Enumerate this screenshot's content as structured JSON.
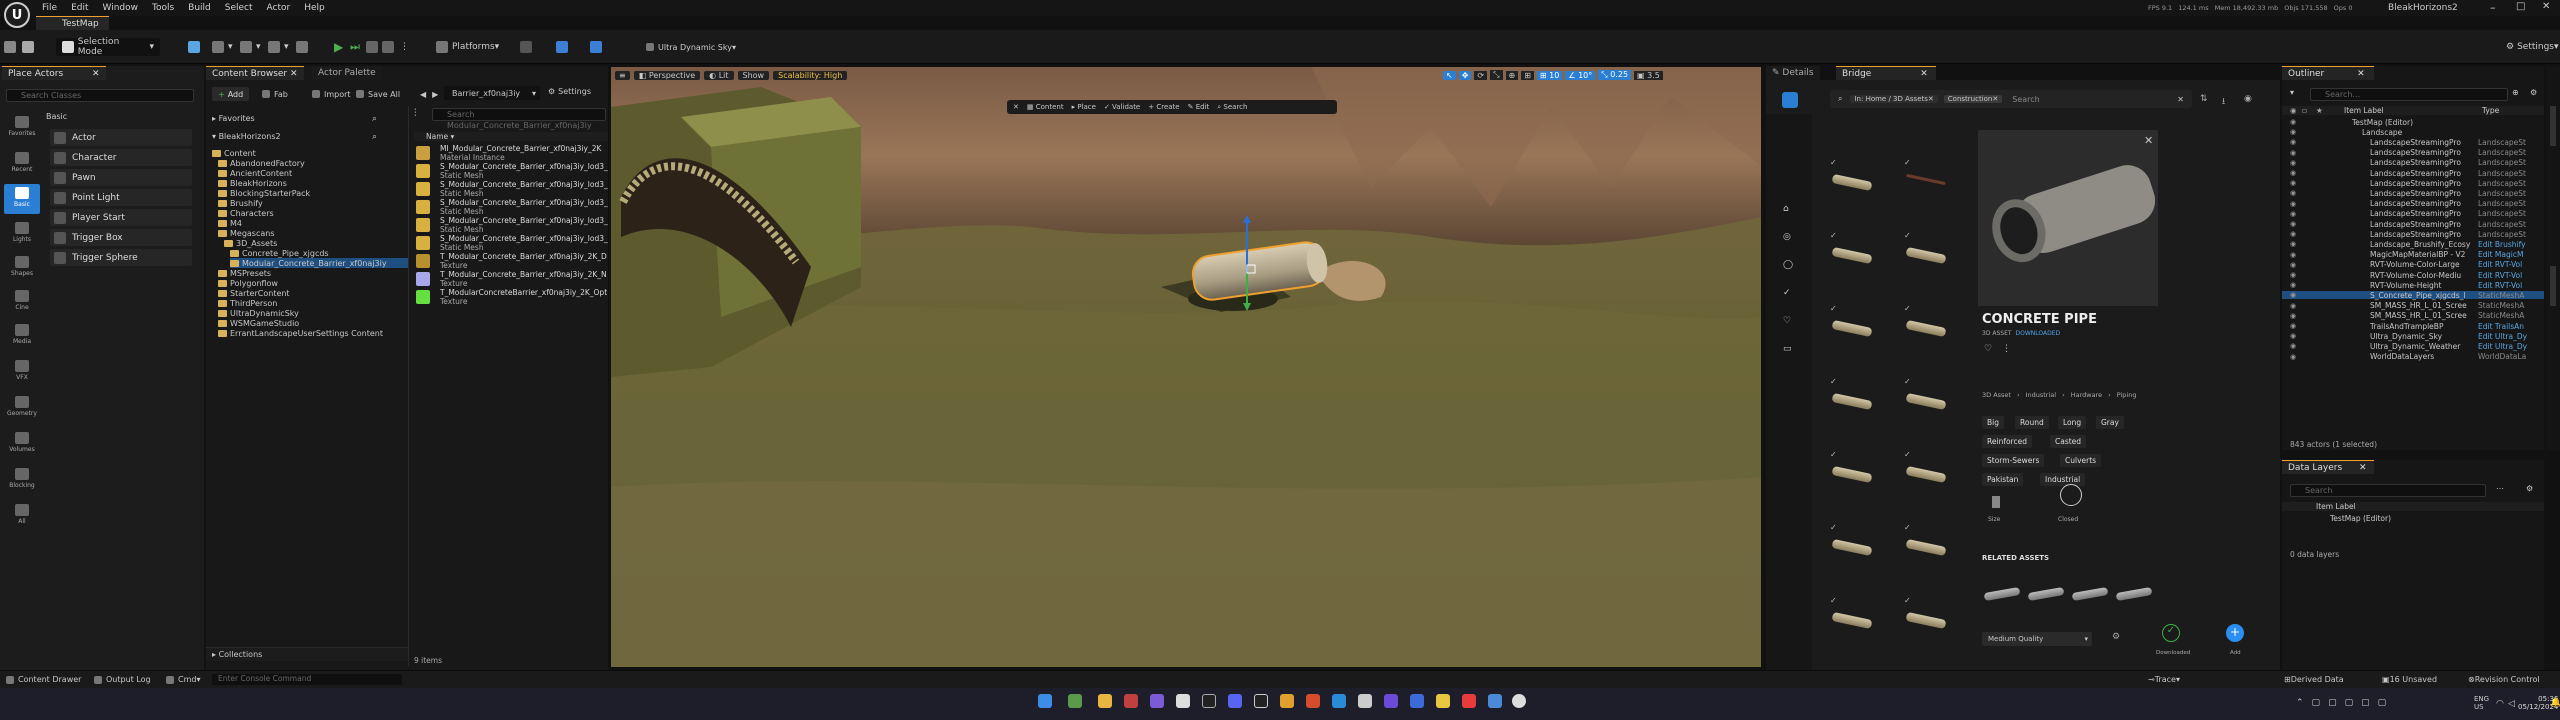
{
  "window": {
    "project_name": "BleakHorizons2",
    "map_tab": "TestMap",
    "menu": [
      "File",
      "Edit",
      "Window",
      "Tools",
      "Build",
      "Select",
      "Actor",
      "Help"
    ],
    "stats": {
      "fps": "FPS 9.1",
      "ms": "124.1 ms",
      "mem": "Mem 18,492.33 mb",
      "objs": "Objs 171,558",
      "ops": "Ops 0"
    }
  },
  "toolbar": {
    "selection_mode": "Selection Mode",
    "platforms": "Platforms",
    "sky": "Ultra Dynamic Sky",
    "settings": "Settings"
  },
  "place_actors": {
    "tab": "Place Actors",
    "search_placeholder": "Search Classes",
    "section": "Basic",
    "categories": [
      "Favorites",
      "Recent",
      "Basic",
      "Lights",
      "Shapes",
      "Cine",
      "Media",
      "VFX",
      "Geometry",
      "Volumes",
      "Blocking",
      "All"
    ],
    "items": [
      "Actor",
      "Character",
      "Pawn",
      "Point Light",
      "Player Start",
      "Trigger Box",
      "Trigger Sphere"
    ]
  },
  "content_browser": {
    "tab": "Content Browser",
    "tab2": "Actor Palette",
    "add": "Add",
    "fab": "Fab",
    "import": "Import",
    "save_all": "Save All",
    "path": "Barrier_xf0naj3iy",
    "settings": "Settings",
    "favorites": "Favorites",
    "project": "BleakHorizons2",
    "search_placeholder": "Search Modular_Concrete_Barrier_xf0naj3iy",
    "column_header": "Name",
    "tree": [
      {
        "label": "Content",
        "depth": 0
      },
      {
        "label": "AbandonedFactory",
        "depth": 1
      },
      {
        "label": "AncientContent",
        "depth": 1
      },
      {
        "label": "BleakHorizons",
        "depth": 1
      },
      {
        "label": "BlockingStarterPack",
        "depth": 1
      },
      {
        "label": "Brushify",
        "depth": 1
      },
      {
        "label": "Characters",
        "depth": 1
      },
      {
        "label": "M4",
        "depth": 1
      },
      {
        "label": "Megascans",
        "depth": 1
      },
      {
        "label": "3D_Assets",
        "depth": 2
      },
      {
        "label": "Concrete_Pipe_xjgcds",
        "depth": 3
      },
      {
        "label": "Modular_Concrete_Barrier_xf0naj3iy",
        "depth": 3
      },
      {
        "label": "MSPresets",
        "depth": 1
      },
      {
        "label": "Polygonflow",
        "depth": 1
      },
      {
        "label": "StarterContent",
        "depth": 1
      },
      {
        "label": "ThirdPerson",
        "depth": 1
      },
      {
        "label": "UltraDynamicSky",
        "depth": 1
      },
      {
        "label": "WSMGameStudio",
        "depth": 1
      },
      {
        "label": "ErrantLandscapeUserSettings Content",
        "depth": 1
      }
    ],
    "assets": [
      {
        "name": "MI_Modular_Concrete_Barrier_xf0naj3iy_2K",
        "type": "Material Instance"
      },
      {
        "name": "S_Modular_Concrete_Barrier_xf0naj3iy_lod3_",
        "type": "Static Mesh"
      },
      {
        "name": "S_Modular_Concrete_Barrier_xf0naj3iy_lod3_",
        "type": "Static Mesh"
      },
      {
        "name": "S_Modular_Concrete_Barrier_xf0naj3iy_lod3_",
        "type": "Static Mesh"
      },
      {
        "name": "S_Modular_Concrete_Barrier_xf0naj3iy_lod3_",
        "type": "Static Mesh"
      },
      {
        "name": "S_Modular_Concrete_Barrier_xf0naj3iy_lod3_",
        "type": "Static Mesh"
      },
      {
        "name": "T_Modular_Concrete_Barrier_xf0naj3iy_2K_D",
        "type": "Texture"
      },
      {
        "name": "T_Modular_Concrete_Barrier_xf0naj3iy_2K_N",
        "type": "Texture"
      },
      {
        "name": "T_ModularConcreteBarrier_xf0naj3iy_2K_Opt",
        "type": "Texture"
      }
    ],
    "collections": "Collections",
    "item_count": "9 items"
  },
  "viewport": {
    "perspective": "Perspective",
    "lit": "Lit",
    "show": "Show",
    "scalability": "Scalability: High",
    "grid_snap": "10",
    "angle_snap": "10°",
    "scale_snap": "0.25",
    "camera_speed": "3.5",
    "float_toolbar": [
      "Content",
      "Place",
      "Validate",
      "Create",
      "Edit"
    ],
    "float_search": "Search"
  },
  "bridge": {
    "tab_details": "Details",
    "tab_bridge": "Bridge",
    "breadcrumb": "In: Home / 3D Assets",
    "filter_chip": "Construction",
    "search_placeholder": "Search",
    "title": "CONCRETE PIPE",
    "subtitle": "3D ASSET",
    "downloaded": "DOWNLOADED",
    "categories": [
      "3D Asset",
      "Industrial",
      "Hardware",
      "Piping"
    ],
    "tags": [
      "Big",
      "Round",
      "Long",
      "Gray",
      "Reinforced",
      "Casted",
      "Storm-Sewers",
      "Culverts",
      "Pakistan",
      "Industrial"
    ],
    "size_label": "Size",
    "closed_label": "Closed",
    "related": "RELATED ASSETS",
    "quality": "Medium Quality",
    "downloaded_btn": "Downloaded",
    "add_btn": "Add"
  },
  "outliner": {
    "tab": "Outliner",
    "search_placeholder": "Search...",
    "col_label": "Item Label",
    "col_type": "Type",
    "rows": [
      {
        "name": "TestMap (Editor)",
        "type": ""
      },
      {
        "name": "Landscape",
        "type": ""
      },
      {
        "name": "LandscapeStreamingPro",
        "type": "LandscapeSt"
      },
      {
        "name": "LandscapeStreamingPro",
        "type": "LandscapeSt"
      },
      {
        "name": "LandscapeStreamingPro",
        "type": "LandscapeSt"
      },
      {
        "name": "LandscapeStreamingPro",
        "type": "LandscapeSt"
      },
      {
        "name": "LandscapeStreamingPro",
        "type": "LandscapeSt"
      },
      {
        "name": "LandscapeStreamingPro",
        "type": "LandscapeSt"
      },
      {
        "name": "LandscapeStreamingPro",
        "type": "LandscapeSt"
      },
      {
        "name": "LandscapeStreamingPro",
        "type": "LandscapeSt"
      },
      {
        "name": "LandscapeStreamingPro",
        "type": "LandscapeSt"
      },
      {
        "name": "LandscapeStreamingPro",
        "type": "LandscapeSt"
      },
      {
        "name": "Landscape_Brushify_Ecosy",
        "type": "Edit Brushify"
      },
      {
        "name": "MagicMapMaterialBP - V2",
        "type": "Edit MagicM"
      },
      {
        "name": "RVT-Volume-Color-Large",
        "type": "Edit RVT-Vol"
      },
      {
        "name": "RVT-Volume-Color-Mediu",
        "type": "Edit RVT-Vol"
      },
      {
        "name": "RVT-Volume-Height",
        "type": "Edit RVT-Vol"
      },
      {
        "name": "S_Concrete_Pipe_xjgcds_l",
        "type": "StaticMeshA"
      },
      {
        "name": "SM_MASS_HR_L_01_Scree",
        "type": "StaticMeshA"
      },
      {
        "name": "SM_MASS_HR_L_01_Scree",
        "type": "StaticMeshA"
      },
      {
        "name": "TrailsAndTrampleBP",
        "type": "Edit TrailsAn"
      },
      {
        "name": "Ultra_Dynamic_Sky",
        "type": "Edit Ultra_Dy"
      },
      {
        "name": "Ultra_Dynamic_Weather",
        "type": "Edit Ultra_Dy"
      },
      {
        "name": "WorldDataLayers",
        "type": "WorldDataLa"
      }
    ],
    "count": "843 actors (1 selected)"
  },
  "data_layers": {
    "tab": "Data Layers",
    "search_placeholder": "Search",
    "col_label": "Item Label",
    "row": "TestMap (Editor)",
    "count": "0 data layers"
  },
  "statusbar": {
    "content_drawer": "Content Drawer",
    "output_log": "Output Log",
    "cmd": "Cmd",
    "console_placeholder": "Enter Console Command",
    "trace": "Trace",
    "derived_data": "Derived Data",
    "unsaved": "16 Unsaved",
    "revision": "Revision Control"
  },
  "taskbar": {
    "lang1": "ENG",
    "lang2": "US",
    "time": "05:36",
    "date": "05/12/2024"
  },
  "colors": {
    "accent": "#f0a030",
    "blue": "#2a7fd4",
    "selected": "#1f4f80"
  }
}
